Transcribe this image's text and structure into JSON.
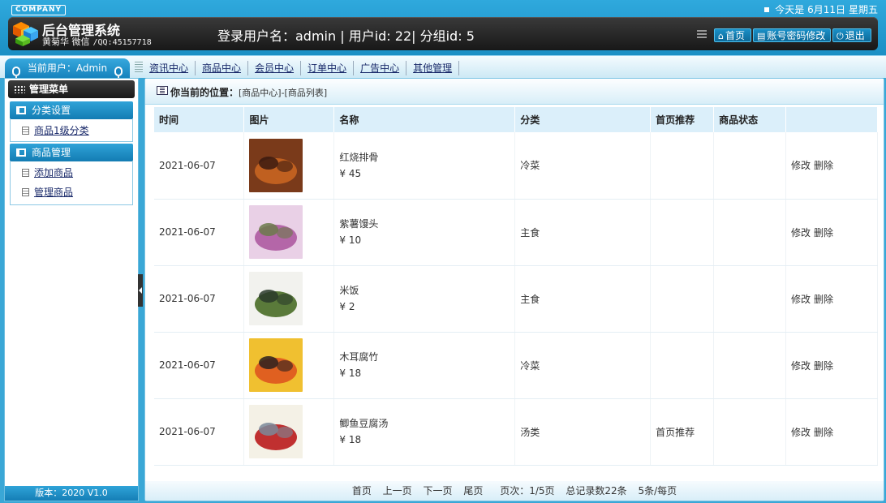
{
  "header": {
    "company": "COMPANY",
    "date_label": "今天是 6月11日",
    "weekday": "星期五",
    "title": "后台管理系统",
    "author": "黄菊华 微信",
    "qq": "/QQ:45157718",
    "login_info": "登录用户名：admin | 用户id: 22| 分组id: 5",
    "home_label": "首页",
    "account_label": "账号密码修改",
    "logout_label": "退出"
  },
  "sub_bar": {
    "current_user": "当前用户：Admin",
    "nav": [
      "资讯中心",
      "商品中心",
      "会员中心",
      "订单中心",
      "广告中心",
      "其他管理"
    ]
  },
  "sidebar": {
    "menu_title": "管理菜单",
    "groups": [
      {
        "title": "分类设置",
        "items": [
          "商品1级分类"
        ]
      },
      {
        "title": "商品管理",
        "items": [
          "添加商品",
          "管理商品"
        ]
      }
    ],
    "version": "版本：2020 V1.0"
  },
  "breadcrumb": {
    "label": "你当前的位置：",
    "path": "[商品中心]-[商品列表]"
  },
  "table": {
    "columns": [
      "时间",
      "图片",
      "名称",
      "分类",
      "首页推荐",
      "商品状态",
      ""
    ],
    "rows": [
      {
        "time": "2021-06-07",
        "name": "红烧排骨",
        "price": "¥ 45",
        "category": "冷菜",
        "recommend": "",
        "status": "",
        "edit": "修改",
        "delete": "删除",
        "colors": [
          "#7a3a1a",
          "#c06020",
          "#3a1a10"
        ]
      },
      {
        "time": "2021-06-07",
        "name": "紫薯馒头",
        "price": "¥ 10",
        "category": "主食",
        "recommend": "",
        "status": "",
        "edit": "修改",
        "delete": "删除",
        "colors": [
          "#e9d0e6",
          "#b466a8",
          "#6b7a4a"
        ]
      },
      {
        "time": "2021-06-07",
        "name": "米饭",
        "price": "¥ 2",
        "category": "主食",
        "recommend": "",
        "status": "",
        "edit": "修改",
        "delete": "删除",
        "colors": [
          "#f2f2ee",
          "#5a7a3a",
          "#2a3a2a"
        ]
      },
      {
        "time": "2021-06-07",
        "name": "木耳腐竹",
        "price": "¥ 18",
        "category": "冷菜",
        "recommend": "",
        "status": "",
        "edit": "修改",
        "delete": "删除",
        "colors": [
          "#f0c030",
          "#e06020",
          "#2a2020"
        ]
      },
      {
        "time": "2021-06-07",
        "name": "鲫鱼豆腐汤",
        "price": "¥ 18",
        "category": "汤类",
        "recommend": "首页推荐",
        "status": "",
        "edit": "修改",
        "delete": "删除",
        "colors": [
          "#f4f1e6",
          "#c03030",
          "#7a8a9a"
        ]
      }
    ]
  },
  "pager": {
    "first": "首页",
    "prev": "上一页",
    "next": "下一页",
    "last": "尾页",
    "page_info": "页次：1/5页",
    "total": "总记录数22条",
    "per_page": "5条/每页"
  }
}
